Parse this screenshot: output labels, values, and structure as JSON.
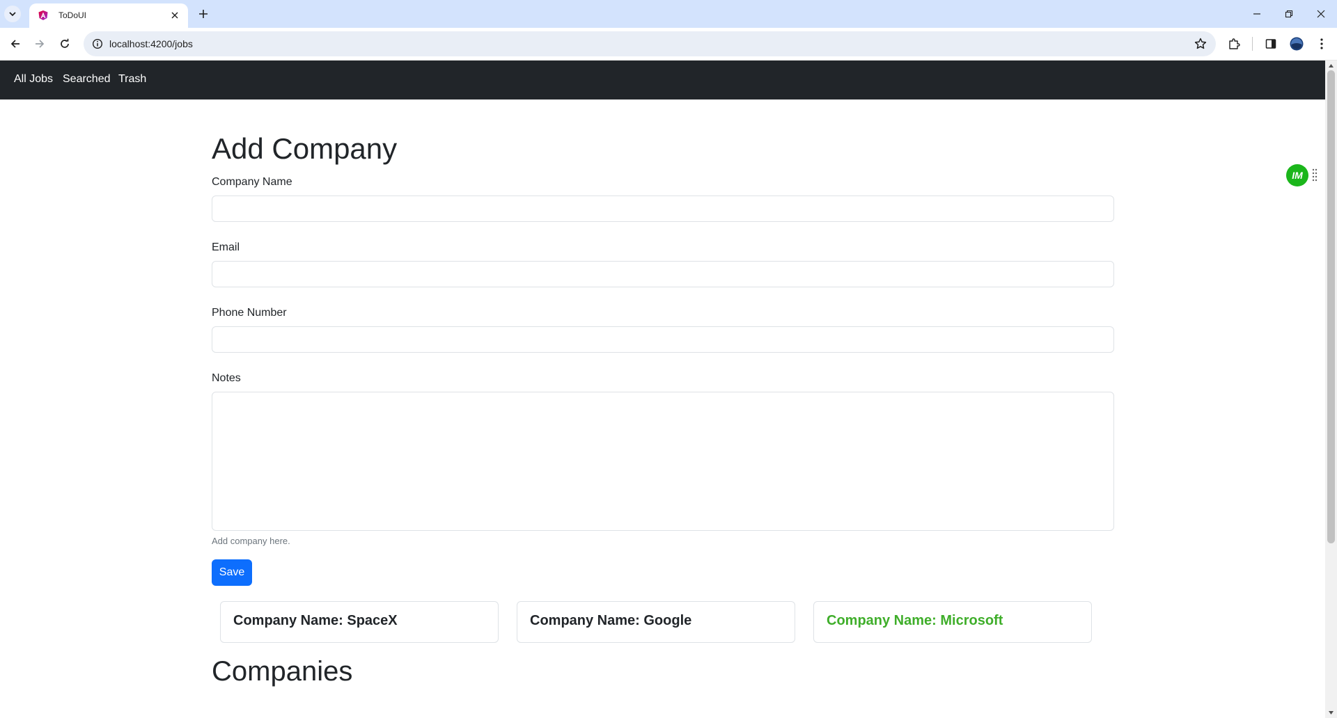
{
  "browser": {
    "tab_title": "ToDoUI",
    "url": "localhost:4200/jobs",
    "icons": {
      "tab_list": "chevron-down-icon",
      "favicon": "angular-icon",
      "tab_close": "close-icon",
      "new_tab": "plus-icon",
      "back": "arrow-left-icon",
      "forward": "arrow-right-icon",
      "reload": "reload-icon",
      "site_info": "info-icon",
      "bookmark": "star-icon",
      "extensions": "puzzle-icon",
      "side_panel": "side-panel-icon",
      "profile": "avatar-icon",
      "menu": "kebab-menu-icon"
    }
  },
  "navbar": {
    "links": [
      {
        "label": "All Jobs"
      },
      {
        "label": "Searched"
      },
      {
        "label": "Trash"
      }
    ]
  },
  "form": {
    "title": "Add Company",
    "fields": {
      "company_name": {
        "label": "Company Name",
        "value": ""
      },
      "email": {
        "label": "Email",
        "value": ""
      },
      "phone": {
        "label": "Phone Number",
        "value": ""
      },
      "notes": {
        "label": "Notes",
        "value": "",
        "help": "Add company here."
      }
    },
    "save_label": "Save"
  },
  "companies": {
    "title": "Companies",
    "cards": [
      {
        "title": "Company Name: SpaceX",
        "color": "#212529"
      },
      {
        "title": "Company Name: Google",
        "color": "#212529"
      },
      {
        "title": "Company Name: Microsoft",
        "color": "#3fae2a"
      }
    ]
  },
  "extension": {
    "badge": "IM",
    "color": "#1bb61b"
  },
  "colors": {
    "navbar_bg": "#212529",
    "primary": "#0d6efd",
    "tabbar_bg": "#d3e3fd"
  }
}
